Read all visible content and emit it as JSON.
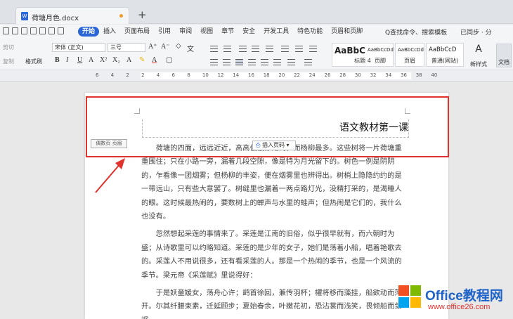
{
  "tabs": {
    "document_title": "荷塘月色.docx",
    "new_tab": "+"
  },
  "menu": {
    "items": [
      "开始",
      "插入",
      "页面布局",
      "引用",
      "审阅",
      "视图",
      "章节",
      "安全",
      "开发工具",
      "特色功能",
      "页眉和页脚"
    ],
    "active": "开始",
    "search": "Q查找命令、搜索模板",
    "sync": "已同步 · 分"
  },
  "ribbon": {
    "cut": "剪切",
    "copy": "复制",
    "format_painter": "格式刷",
    "font_name": "宋体 (正文)",
    "font_size": "三号",
    "grow_font": "A⁺",
    "shrink_font": "A⁻",
    "bold": "B",
    "italic": "I",
    "underline": "U",
    "styles": [
      {
        "sample": "AaBbC",
        "label": "标题 4"
      },
      {
        "sample": "AaBbCcDd",
        "label": "页脚"
      },
      {
        "sample": "AaBbCcDd",
        "label": "页眉"
      },
      {
        "sample": "AaBbCcD",
        "label": "普通(网站)"
      }
    ],
    "new_style": "新样式",
    "text_tool": "文档"
  },
  "ruler": {
    "marks": [
      "6",
      "4",
      "2",
      "2",
      "4",
      "6",
      "8",
      "10",
      "12",
      "14",
      "16",
      "18",
      "20",
      "22",
      "24",
      "26",
      "28",
      "30",
      "32",
      "34",
      "36",
      "38",
      "40"
    ]
  },
  "page": {
    "header_title": "语文教材第一课",
    "header_tag": "偶数页 页眉",
    "insert_page_number": "插入页码",
    "paragraphs": [
      "荷塘的四面，远远近近，高高低低都是树，而杨柳最多。这些树将一片荷塘重重围住；只在小路一旁，漏着几段空隙，像是特为月光留下的。树色一例是阴阴的，乍看像一团烟雾；但杨柳的丰姿，便在烟雾里也辨得出。树梢上隐隐约约的是一带远山，只有些大意罢了。树缝里也漏着一两点路灯光，没精打采的，是渴睡人的眼。这时候最热闹的，要数树上的蝉声与水里的蛙声；但热闹是它们的，我什么也没有。",
      "忽然想起采莲的事情来了。采莲是江南的旧俗，似乎很早就有，而六朝时为盛；从诗歌里可以约略知道。采莲的是少年的女子，她们是荡着小船，唱着艳歌去的。采莲人不用说很多，还有看采莲的人。那是一个热闹的季节，也是一个风流的季节。梁元帝《采莲赋》里说得好：",
      "于是妖童媛女，荡舟心许；鹢首徐回，兼传羽杯；欋将移而藻挂，船欲动而萍开。尔其纤腰束素，迁延顾步；夏始春余，叶嫩花初，恐沾裳而浅笑，畏倾船而敛裾。"
    ]
  },
  "watermark": {
    "brand": "Office教程网",
    "url": "www.office26.com"
  },
  "colors": {
    "accent": "#2b66d9",
    "annotation": "#e0332d"
  }
}
